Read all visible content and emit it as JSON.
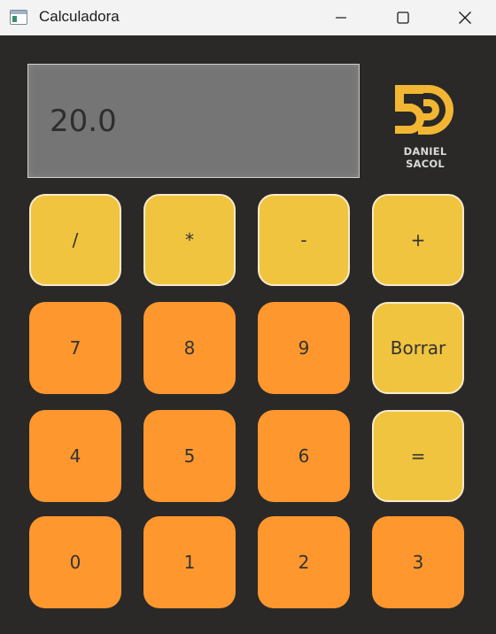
{
  "window": {
    "title": "Calculadora",
    "icons": {
      "app": "app-window-icon",
      "minimize": "minimize-icon",
      "maximize": "maximize-icon",
      "close": "close-icon"
    }
  },
  "display": {
    "value": "20.0"
  },
  "logo": {
    "text": "DANIEL SACOL",
    "icon": "5d-logo-icon"
  },
  "colors": {
    "background": "#2a2928",
    "display": "#767575",
    "operator_key": "#f0c43f",
    "number_key": "#fd972e",
    "logo_gold": "#f2b632"
  },
  "keypad": {
    "row1": [
      "/",
      "*",
      "-",
      "+"
    ],
    "row2": [
      "7",
      "8",
      "9",
      "Borrar"
    ],
    "row3": [
      "4",
      "5",
      "6",
      "="
    ],
    "row4": [
      "0",
      "1",
      "2",
      "3"
    ]
  }
}
